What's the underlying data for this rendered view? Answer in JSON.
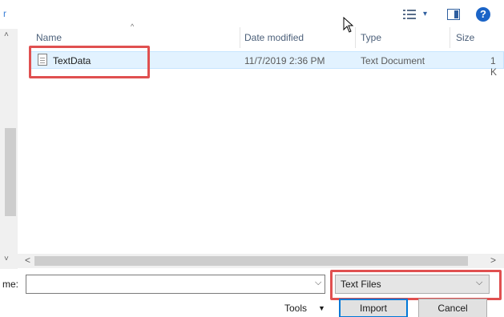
{
  "toolbar": {
    "left_glyph": "r",
    "view_icon": "details-view-icon",
    "view_caret": "▾",
    "pane_icon": "preview-pane-icon",
    "help_icon": "?"
  },
  "file_list": {
    "sort_indicator": "^",
    "columns": [
      "Name",
      "Date modified",
      "Type",
      "Size"
    ],
    "rows": [
      {
        "name": "TextData",
        "date": "11/7/2019 2:36 PM",
        "type": "Text Document",
        "size": "1 K"
      }
    ]
  },
  "scrollbars": {
    "up": "˄",
    "down": "˅",
    "left": "<",
    "right": ">"
  },
  "footer": {
    "file_name_label": "me:",
    "file_name_value": "",
    "file_type_selected": "Text Files",
    "tools_label": "Tools",
    "tools_caret": "▼",
    "import_label": "Import",
    "cancel_label": "Cancel"
  },
  "colors": {
    "annotation": "#e05050",
    "selection": "#cce8ff",
    "accent": "#0078d7"
  }
}
